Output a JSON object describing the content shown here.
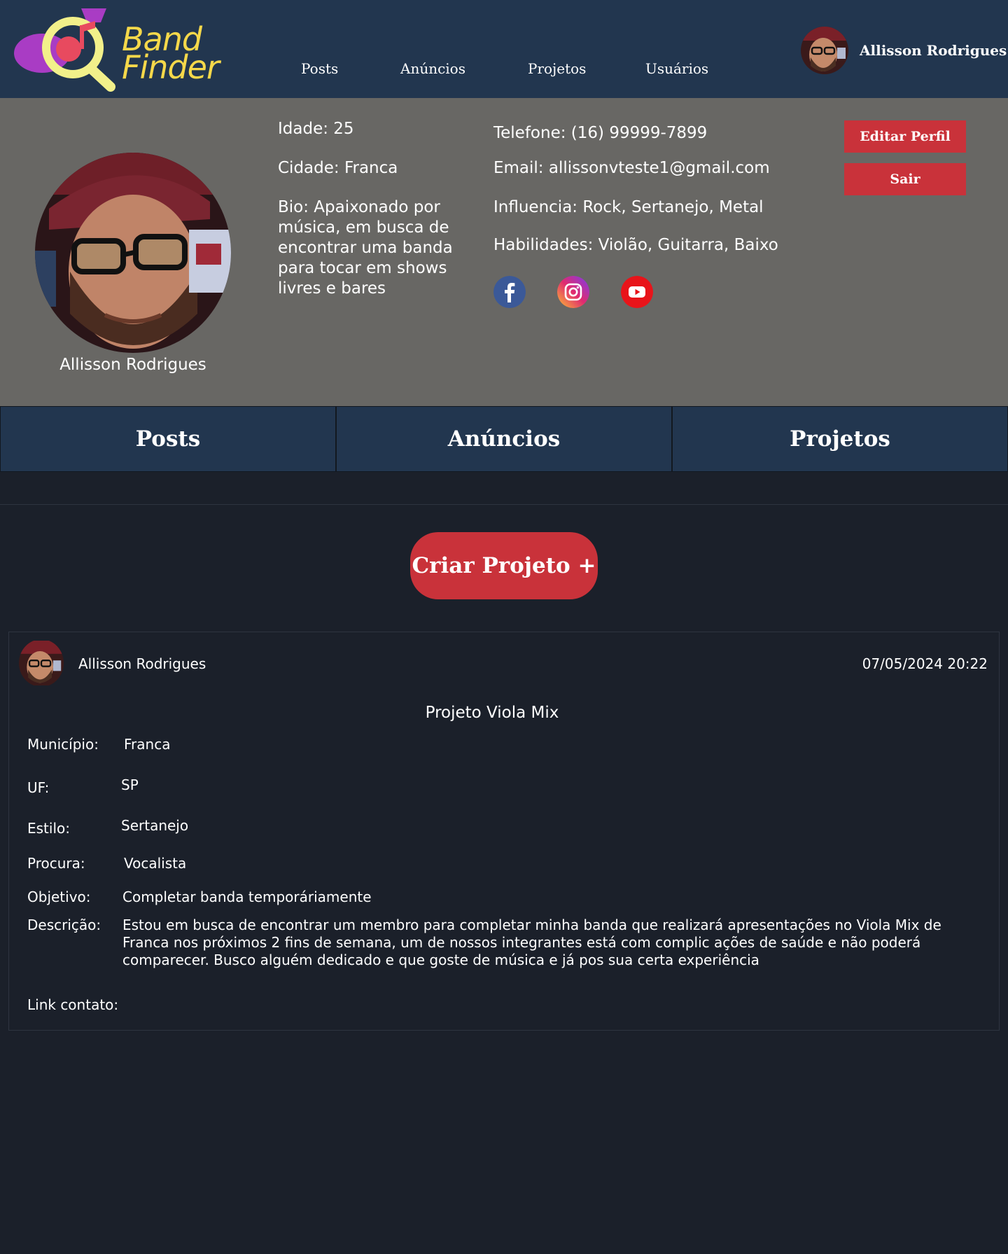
{
  "header": {
    "logo_line1": "Band",
    "logo_line2": "Finder",
    "nav": [
      "Posts",
      "Anúncios",
      "Projetos",
      "Usuários"
    ],
    "user_name": "Allisson Rodrigues"
  },
  "profile": {
    "name": "Allisson Rodrigues",
    "age": "Idade: 25",
    "city": "Cidade: Franca",
    "bio": "Bio: Apaixonado por música, em busca de encontrar uma banda para tocar em shows livres e bares",
    "phone": "Telefone: (16) 99999-7899",
    "email": "Email: allissonvteste1@gmail.com",
    "influences": "Influencia: Rock, Sertanejo, Metal",
    "skills": "Habilidades: Violão, Guitarra, Baixo",
    "social_icons": [
      "facebook-icon",
      "instagram-icon",
      "youtube-icon"
    ],
    "edit_button": "Editar Perfil",
    "logout_button": "Sair"
  },
  "tabs": [
    "Posts",
    "Anúncios",
    "Projetos"
  ],
  "create_button": "Criar Projeto +",
  "project": {
    "author": "Allisson Rodrigues",
    "date": "07/05/2024 20:22",
    "title": "Projeto Viola Mix",
    "labels": {
      "city": "Município:",
      "uf": "UF:",
      "style": "Estilo:",
      "seeking": "Procura:",
      "goal": "Objetivo:",
      "description": "Descrição:",
      "contact": "Link contato:"
    },
    "city": "Franca",
    "uf": "SP",
    "style": "Sertanejo",
    "seeking": "Vocalista",
    "goal": "Completar banda temporáriamente",
    "description": "Estou em busca de encontrar um membro para completar minha banda que realizará apresentações no Viola Mix de Franca nos próximos 2 fins de semana, um de nossos integrantes está com complic ações de saúde e não poderá comparecer. Busco alguém dedicado e que goste de música e já pos sua certa experiência",
    "contact": ""
  },
  "colors": {
    "header_bg": "#22364f",
    "profile_bg": "#686764",
    "page_bg": "#1b202a",
    "accent_red": "#c9323a",
    "logo_yellow": "#f5d84a"
  }
}
